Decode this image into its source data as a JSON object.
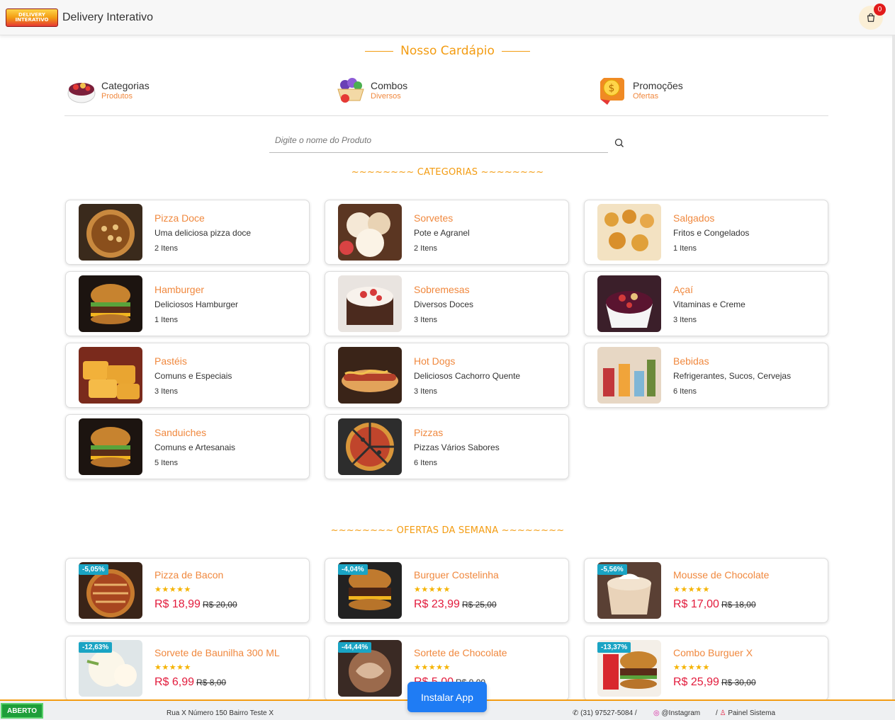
{
  "header": {
    "logo_text": "DELIVERY INTERATIVO",
    "brand": "Delivery Interativo",
    "cart_count": "0"
  },
  "menu_title": "Nosso Cardápio",
  "nav": [
    {
      "label": "Categorias",
      "sub": "Produtos"
    },
    {
      "label": "Combos",
      "sub": "Diversos"
    },
    {
      "label": "Promoções",
      "sub": "Ofertas"
    }
  ],
  "search": {
    "placeholder": "Digite o nome do Produto"
  },
  "categories_title": "~~~~~~~~ CATEGORIAS ~~~~~~~~",
  "categories": [
    {
      "name": "Pizza Doce",
      "desc": "Uma deliciosa pizza doce",
      "count": "2 Itens"
    },
    {
      "name": "Sorvetes",
      "desc": "Pote e Agranel",
      "count": "2 Itens"
    },
    {
      "name": "Salgados",
      "desc": "Fritos e Congelados",
      "count": "1 Itens"
    },
    {
      "name": "Hamburger",
      "desc": "Deliciosos Hamburger",
      "count": "1 Itens"
    },
    {
      "name": "Sobremesas",
      "desc": "Diversos Doces",
      "count": "3 Itens"
    },
    {
      "name": "Açaí",
      "desc": "Vitaminas e Creme",
      "count": "3 Itens"
    },
    {
      "name": "Pastéis",
      "desc": "Comuns e Especiais",
      "count": "3 Itens"
    },
    {
      "name": "Hot Dogs",
      "desc": "Deliciosos Cachorro Quente",
      "count": "3 Itens"
    },
    {
      "name": "Bebidas",
      "desc": "Refrigerantes, Sucos, Cervejas",
      "count": "6 Itens"
    },
    {
      "name": "Sanduiches",
      "desc": "Comuns e Artesanais",
      "count": "5 Itens"
    },
    {
      "name": "Pizzas",
      "desc": "Pizzas Vários Sabores",
      "count": "6 Itens"
    }
  ],
  "offers_title": "~~~~~~~~ OFERTAS DA SEMANA ~~~~~~~~",
  "offers": [
    {
      "name": "Pizza de Bacon",
      "discount": "-5,05%",
      "price": "R$ 18,99",
      "old_price": "R$ 20,00",
      "stars": "★★★★★"
    },
    {
      "name": "Burguer Costelinha",
      "discount": "-4,04%",
      "price": "R$ 23,99",
      "old_price": "R$ 25,00",
      "stars": "★★★★★"
    },
    {
      "name": "Mousse de Chocolate",
      "discount": "-5,56%",
      "price": "R$ 17,00",
      "old_price": "R$ 18,00",
      "stars": "★★★★★"
    },
    {
      "name": "Sorvete de Baunilha 300 ML",
      "discount": "-12,63%",
      "price": "R$ 6,99",
      "old_price": "R$ 8,00",
      "stars": "★★★★★"
    },
    {
      "name": "Sortete de Chocolate",
      "discount": "-44,44%",
      "price": "R$ 5,00",
      "old_price": "R$ 9,00",
      "stars": "★★★★★"
    },
    {
      "name": "Combo Burguer X",
      "discount": "-13,37%",
      "price": "R$ 25,99",
      "old_price": "R$ 30,00",
      "stars": "★★★★★"
    }
  ],
  "install_button": "Instalar App",
  "footer": {
    "status": "ABERTO",
    "address": "Rua X Número 150 Bairro Teste X",
    "phone": "(31) 97527-5084 /",
    "instagram": "@Instagram",
    "painel": "Painel Sistema"
  },
  "colors": {
    "accent": "#f39c12",
    "title": "#f0883e",
    "price": "#e21b3c",
    "discount": "#1aa4c4",
    "open": "#1e9e3a",
    "install": "#1f7cf4"
  }
}
